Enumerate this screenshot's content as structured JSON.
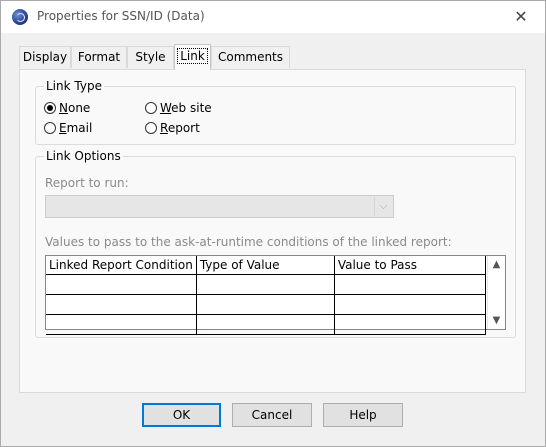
{
  "window": {
    "title": "Properties for SSN/ID (Data)",
    "app_icon": "app-globe-icon",
    "close_glyph": "✕"
  },
  "tabs": [
    {
      "label": "Display",
      "active": false
    },
    {
      "label": "Format",
      "active": false
    },
    {
      "label": "Style",
      "active": false
    },
    {
      "label": "Link",
      "active": true
    },
    {
      "label": "Comments",
      "active": false
    }
  ],
  "link_type": {
    "legend": "Link Type",
    "options": [
      {
        "label": "None",
        "checked": true
      },
      {
        "label": "Web site",
        "checked": false
      },
      {
        "label": "Email",
        "checked": false
      },
      {
        "label": "Report",
        "checked": false
      }
    ]
  },
  "link_options": {
    "legend": "Link Options",
    "report_label": "Report to run:",
    "report_value": "",
    "values_label": "Values to pass to the ask-at-runtime conditions of the linked report:",
    "columns": [
      "Linked Report Condition",
      "Type of Value",
      "Value to Pass"
    ],
    "rows": [
      [
        "",
        "",
        ""
      ],
      [
        "",
        "",
        ""
      ],
      [
        "",
        "",
        ""
      ]
    ]
  },
  "buttons": {
    "ok": "OK",
    "cancel": "Cancel",
    "help": "Help"
  }
}
